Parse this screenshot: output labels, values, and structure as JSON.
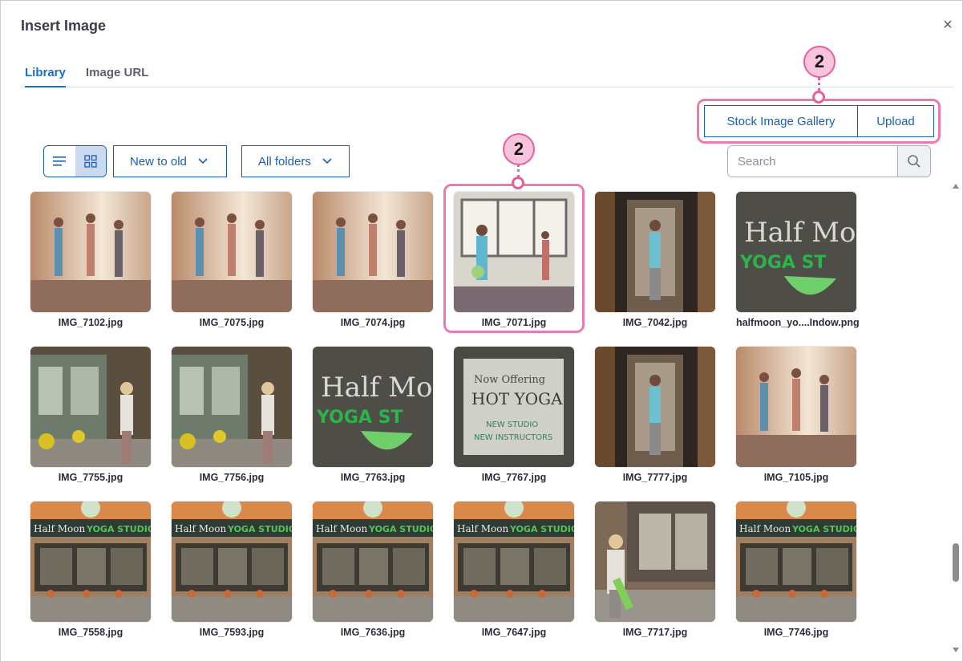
{
  "dialog": {
    "title": "Insert Image",
    "close_label": "×",
    "tabs": [
      {
        "label": "Library",
        "active": true
      },
      {
        "label": "Image URL",
        "active": false
      }
    ]
  },
  "toolbar": {
    "stock_label": "Stock Image Gallery",
    "upload_label": "Upload",
    "sort_label": "New to old",
    "folder_label": "All folders",
    "search_placeholder": "Search",
    "view_mode": "grid"
  },
  "callouts": [
    {
      "number": "2"
    },
    {
      "number": "2"
    }
  ],
  "images": [
    {
      "name": "IMG_7102.jpg",
      "scene": "yoga-bright"
    },
    {
      "name": "IMG_7075.jpg",
      "scene": "yoga-bright"
    },
    {
      "name": "IMG_7074.jpg",
      "scene": "yoga-bright"
    },
    {
      "name": "IMG_7071.jpg",
      "scene": "yoga-window"
    },
    {
      "name": "IMG_7042.jpg",
      "scene": "doorway-dark"
    },
    {
      "name": "halfmoon_yo....Indow.png",
      "scene": "sign-green"
    },
    {
      "name": "IMG_7755.jpg",
      "scene": "street-flowers"
    },
    {
      "name": "IMG_7756.jpg",
      "scene": "street-flowers"
    },
    {
      "name": "IMG_7763.jpg",
      "scene": "sign-green"
    },
    {
      "name": "IMG_7767.jpg",
      "scene": "sign-poster"
    },
    {
      "name": "IMG_7777.jpg",
      "scene": "doorway-dark"
    },
    {
      "name": "IMG_7105.jpg",
      "scene": "yoga-bright"
    },
    {
      "name": "IMG_7558.jpg",
      "scene": "storefront"
    },
    {
      "name": "IMG_7593.jpg",
      "scene": "storefront"
    },
    {
      "name": "IMG_7636.jpg",
      "scene": "storefront"
    },
    {
      "name": "IMG_7647.jpg",
      "scene": "storefront"
    },
    {
      "name": "IMG_7717.jpg",
      "scene": "street-walk"
    },
    {
      "name": "IMG_7746.jpg",
      "scene": "storefront"
    }
  ],
  "colors": {
    "accent": "#1b5fb3",
    "tab_active": "#1a6fc9",
    "highlight": "#ea7bb0",
    "callout_fill": "#f8c3dc"
  }
}
